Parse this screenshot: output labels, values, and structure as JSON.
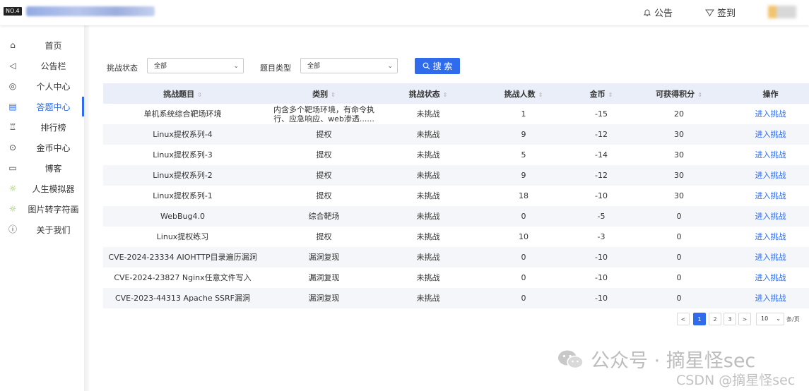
{
  "header": {
    "badge": "NO.4",
    "notice_label": "公告",
    "checkin_label": "签到",
    "notice_icon": "bell-icon",
    "checkin_icon": "badge-icon"
  },
  "sidebar": {
    "items": [
      {
        "label": "首页",
        "icon": "home-icon",
        "glyph": "⌂"
      },
      {
        "label": "公告栏",
        "icon": "megaphone-icon",
        "glyph": "◁"
      },
      {
        "label": "个人中心",
        "icon": "user-icon",
        "glyph": "◎"
      },
      {
        "label": "答题中心",
        "icon": "clipboard-icon",
        "glyph": "▤"
      },
      {
        "label": "排行榜",
        "icon": "trophy-icon",
        "glyph": "♖"
      },
      {
        "label": "金币中心",
        "icon": "coin-icon",
        "glyph": "⊙"
      },
      {
        "label": "博客",
        "icon": "blog-icon",
        "glyph": "▭"
      },
      {
        "label": "人生模拟器",
        "icon": "bulb-icon",
        "glyph": "☼"
      },
      {
        "label": "图片转字符画",
        "icon": "bulb-icon",
        "glyph": "☼"
      },
      {
        "label": "关于我们",
        "icon": "info-icon",
        "glyph": "ⓘ"
      }
    ],
    "active_index": 3
  },
  "filters": {
    "status_label": "挑战状态",
    "status_value": "全部",
    "type_label": "题目类型",
    "type_value": "全部",
    "search_label": "搜 索"
  },
  "table": {
    "headers": [
      "挑战题目",
      "类别",
      "挑战状态",
      "挑战人数",
      "金币",
      "可获得积分",
      "操作"
    ],
    "rows": [
      [
        "单机系统综合靶场环境",
        "内含多个靶场环境，有命令执行、应急响应、web渗透......",
        "未挑战",
        "1",
        "-15",
        "20",
        "进入挑战"
      ],
      [
        "Linux提权系列-4",
        "提权",
        "未挑战",
        "9",
        "-12",
        "30",
        "进入挑战"
      ],
      [
        "Linux提权系列-3",
        "提权",
        "未挑战",
        "5",
        "-14",
        "30",
        "进入挑战"
      ],
      [
        "Linux提权系列-2",
        "提权",
        "未挑战",
        "9",
        "-12",
        "30",
        "进入挑战"
      ],
      [
        "Linux提权系列-1",
        "提权",
        "未挑战",
        "18",
        "-10",
        "30",
        "进入挑战"
      ],
      [
        "WebBug4.0",
        "综合靶场",
        "未挑战",
        "0",
        "-5",
        "0",
        "进入挑战"
      ],
      [
        "Linux提权练习",
        "提权",
        "未挑战",
        "10",
        "-3",
        "0",
        "进入挑战"
      ],
      [
        "CVE-2024-23334 AIOHTTP目录遍历漏洞",
        "漏洞复现",
        "未挑战",
        "0",
        "-10",
        "0",
        "进入挑战"
      ],
      [
        "CVE-2024-23827 Nginx任意文件写入",
        "漏洞复现",
        "未挑战",
        "0",
        "-10",
        "0",
        "进入挑战"
      ],
      [
        "CVE-2023-44313 Apache SSRF漏洞",
        "漏洞复现",
        "未挑战",
        "0",
        "-10",
        "0",
        "进入挑战"
      ]
    ]
  },
  "pagination": {
    "prev": "<",
    "pages": [
      "1",
      "2",
      "3"
    ],
    "next": ">",
    "current": "1",
    "page_size": "10",
    "page_size_unit": "条/页"
  },
  "watermark": {
    "line1": "公众号 · 摘星怪sec",
    "line2": "CSDN @摘星怪sec"
  }
}
